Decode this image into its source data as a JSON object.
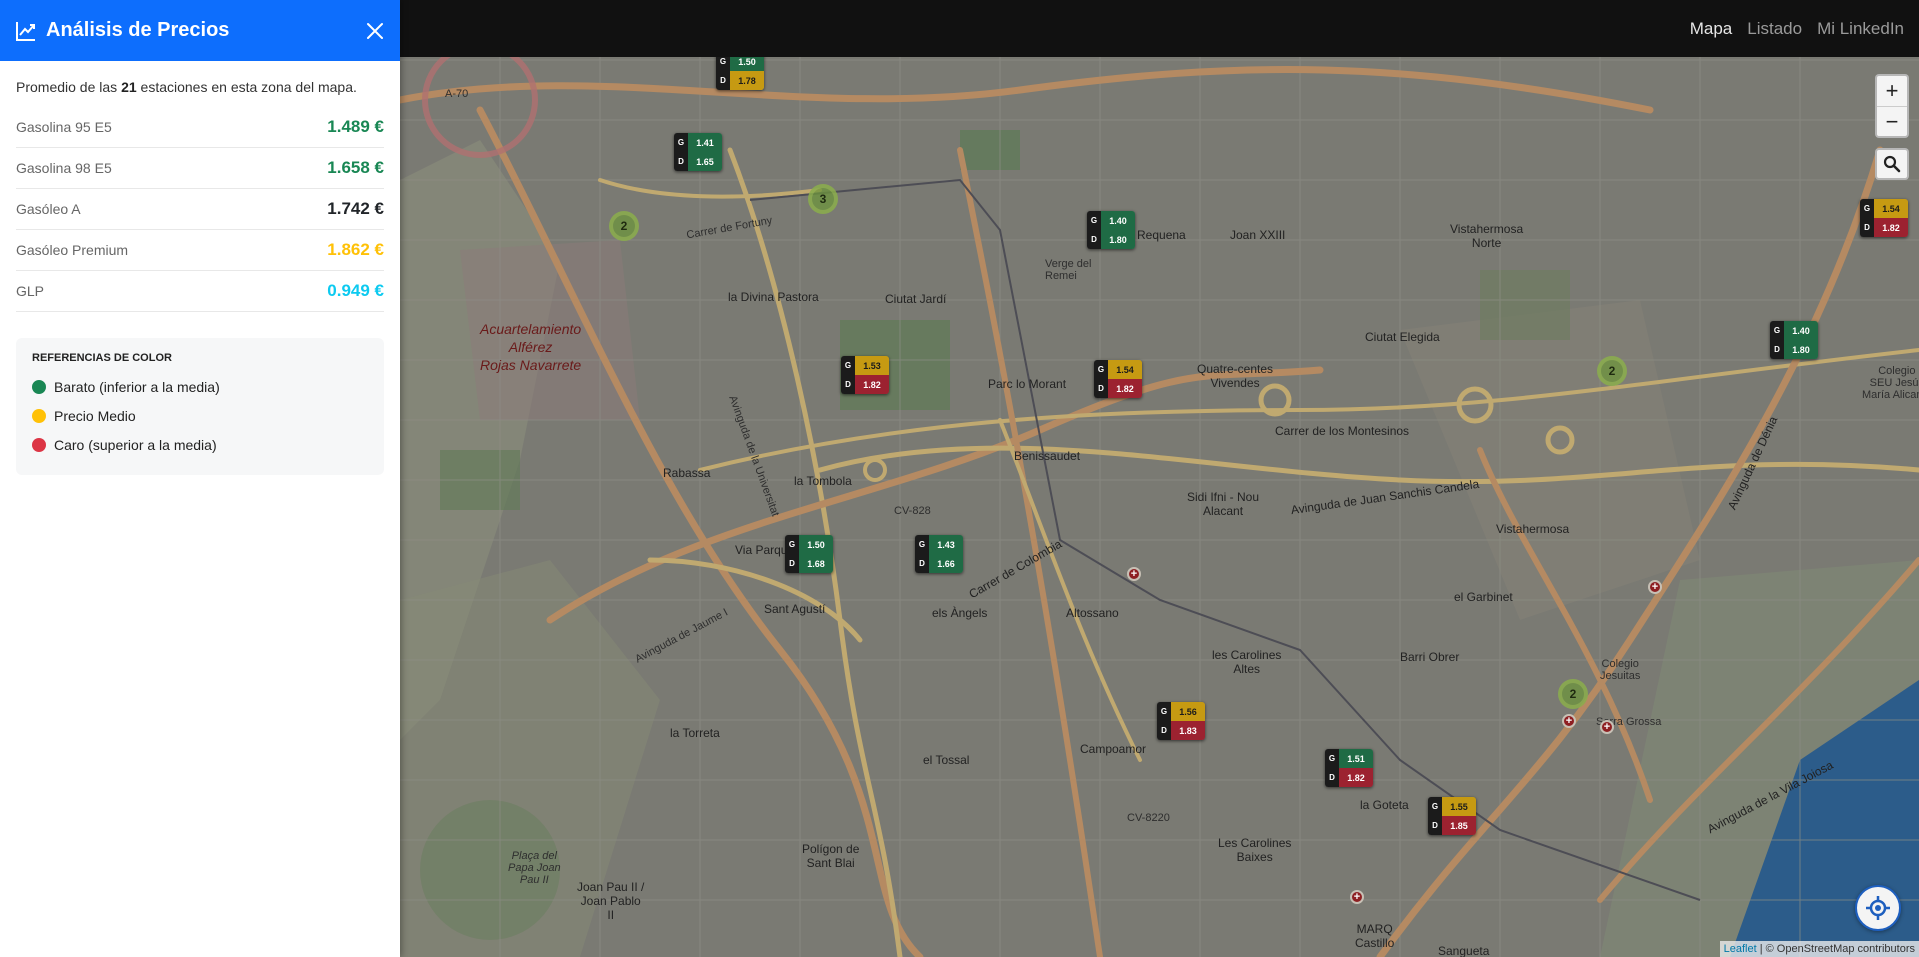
{
  "panel": {
    "title": "Análisis de Precios",
    "summary_prefix": "Promedio de las",
    "summary_count": "21",
    "summary_suffix": "estaciones en esta zona del mapa.",
    "fuels": [
      {
        "name": "Gasolina 95 E5",
        "price": "1.489 €",
        "color": "#198754"
      },
      {
        "name": "Gasolina 98 E5",
        "price": "1.658 €",
        "color": "#198754"
      },
      {
        "name": "Gasóleo A",
        "price": "1.742 €",
        "color": "#212529"
      },
      {
        "name": "Gasóleo Premium",
        "price": "1.862 €",
        "color": "#ffc107"
      },
      {
        "name": "GLP",
        "price": "0.949 €",
        "color": "#0dcaf0"
      }
    ],
    "legend": {
      "title": "REFERENCIAS DE COLOR",
      "items": [
        {
          "label": "Barato (inferior a la media)",
          "color": "#198754"
        },
        {
          "label": "Precio Medio",
          "color": "#ffc107"
        },
        {
          "label": "Caro (superior a la media)",
          "color": "#dc3545"
        }
      ]
    }
  },
  "nav": {
    "items": [
      "Mapa",
      "Listado",
      "Mi LinkedIn"
    ],
    "active": "Mapa"
  },
  "map": {
    "attribution_leaflet": "Leaflet",
    "attribution_rest": "| © OpenStreetMap contributors",
    "labels": {
      "l1": "Acuartelamiento\nAlférez\nRojas Navarrete",
      "l2": "Ciutat Jardí",
      "l3": "la Divina Pastora",
      "l4": "Verge del\nRemei",
      "l5": "Requena",
      "l6": "Joan XXIII",
      "l7": "Vistahermosa\nNorte",
      "l8": "Ciutat Elegida",
      "l9": "Quatre-centes\nVivendes",
      "l10": "Parc lo Morant",
      "l11": "Benissaudet",
      "l12": "Carrer de los Montesinos",
      "l13": "Avinguda de Juan Sanchis Candela",
      "l14": "Sidi Ifni - Nou\nAlacant",
      "l15": "Rabassa",
      "l16": "la Tombola",
      "l17": "Via Parque",
      "l18": "Sant Agustí",
      "l19": "els Àngels",
      "l20": "Altossano",
      "l21": "les Carolines\nAltes",
      "l22": "el Garbinet",
      "l23": "Barri Obrer",
      "l24": "Vistahermosa",
      "l25": "la Torreta",
      "l26": "el Tossal",
      "l27": "Campoamor",
      "l28": "la Goteta",
      "l29": "Les Carolines\nBaixes",
      "l30": "Polígon de\nSant Blai",
      "l31": "Joan Pau II /\nJoan Pablo\nII",
      "l32": "Plaça del\nPapa Joan\nPau II",
      "l33": "MARQ\nCastillo",
      "l34": "Sangueta",
      "l35": "Serra Grossa",
      "l36": "Colegio\nJesuitas",
      "l37": "CV-828",
      "l38": "CV-8220",
      "l39": "Avinguda de la Universitat",
      "l40": "Carrer de Colombia",
      "l41": "Avinguda de Dénia",
      "l42": "A-70",
      "l43": "Carrer de Fortuny",
      "l44": "Avinguda de la Vila Joiosa",
      "l45": "Avinguda de Jaume I",
      "l46": "Colegio\nSEU Jesús\nMaría Alicante"
    },
    "stations": [
      {
        "g": "1.50",
        "d": "1.78",
        "gc": "green",
        "dc": "yellow"
      },
      {
        "g": "1.41",
        "d": "1.65",
        "gc": "green",
        "dc": "green"
      },
      {
        "g": "1.40",
        "d": "1.80",
        "gc": "green",
        "dc": "green"
      },
      {
        "g": "1.54",
        "d": "1.82",
        "gc": "yellow",
        "dc": "red"
      },
      {
        "g": "1.40",
        "d": "1.80",
        "gc": "green",
        "dc": "green"
      },
      {
        "g": "1.53",
        "d": "1.82",
        "gc": "yellow",
        "dc": "red"
      },
      {
        "g": "1.54",
        "d": "1.82",
        "gc": "yellow",
        "dc": "red"
      },
      {
        "g": "1.50",
        "d": "1.68",
        "gc": "green",
        "dc": "green"
      },
      {
        "g": "1.43",
        "d": "1.66",
        "gc": "green",
        "dc": "green"
      },
      {
        "g": "1.56",
        "d": "1.83",
        "gc": "yellow",
        "dc": "red"
      },
      {
        "g": "1.51",
        "d": "1.82",
        "gc": "green",
        "dc": "red"
      },
      {
        "g": "1.55",
        "d": "1.85",
        "gc": "yellow",
        "dc": "red"
      }
    ],
    "clusters": [
      "2",
      "3",
      "2",
      "2"
    ],
    "fuel_key_g": "G",
    "fuel_key_d": "D"
  },
  "icons": {
    "header": "chart-line-icon",
    "close": "close-icon",
    "search": "search-icon",
    "locate": "locate-icon",
    "pharmacy": "pharmacy-icon"
  }
}
